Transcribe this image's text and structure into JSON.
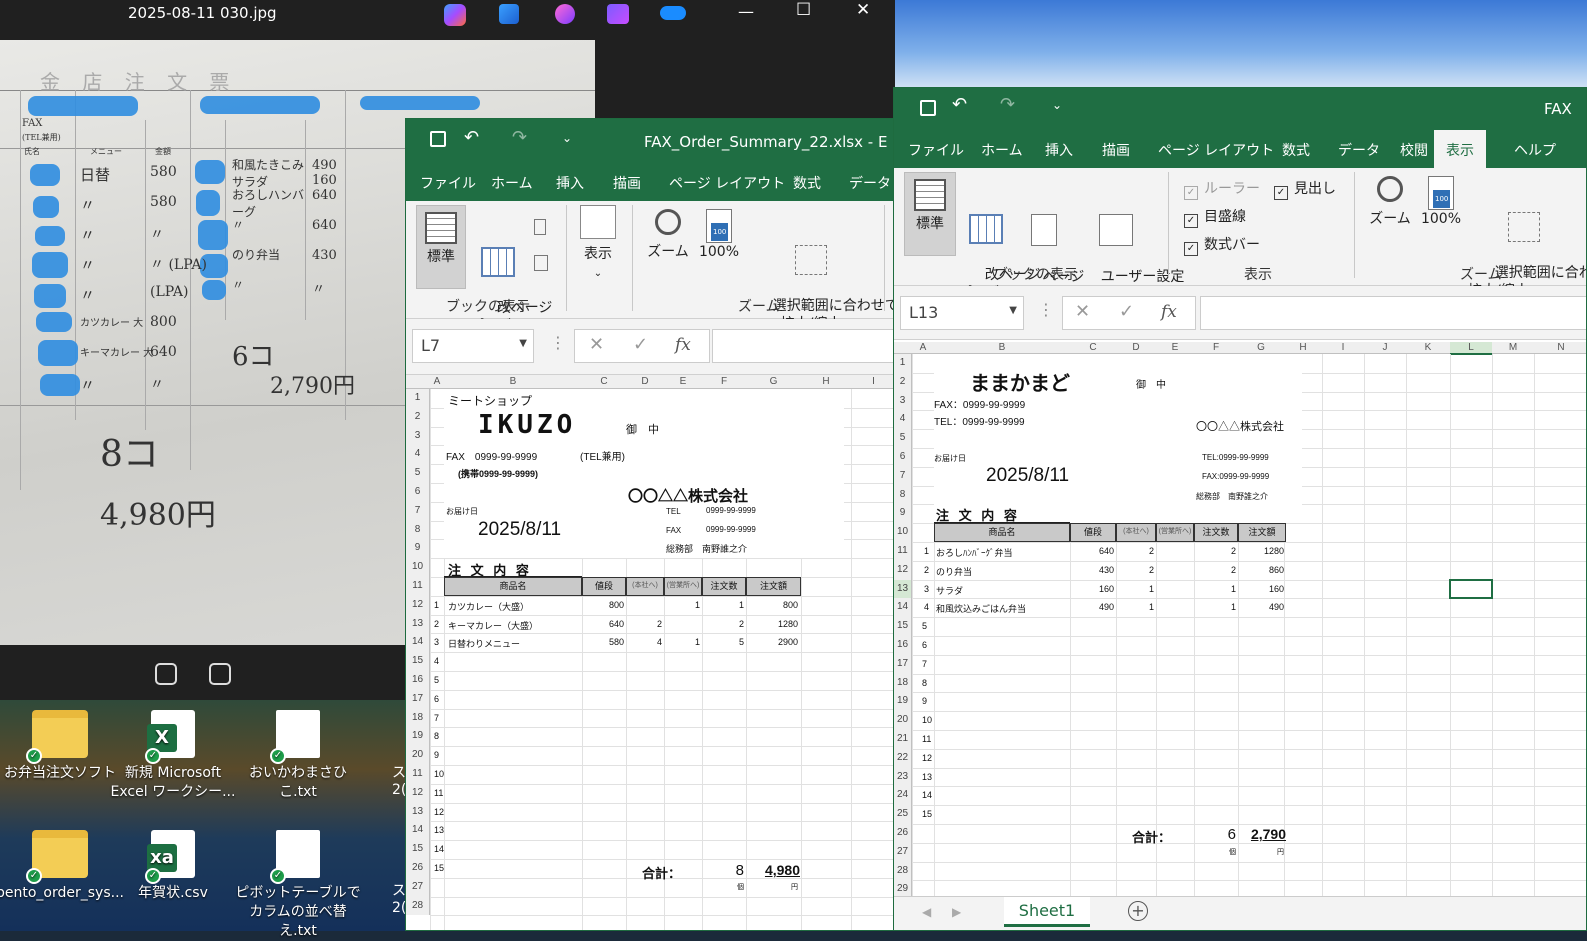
{
  "photo_viewer": {
    "title": "2025-08-11 030.jpg",
    "min_glyph": "—",
    "max_glyph": "☐",
    "close_glyph": "✕",
    "handwriting": {
      "header": "金 店 注 文 票",
      "fax_tel": "FAX",
      "tel_label": "(TEL兼用)",
      "col_name": "氏名",
      "col_menu": "メニュー",
      "col_price": "金額",
      "rows": [
        {
          "menu": "日替",
          "price": "580",
          "menu2": "和風たきこみ サラダ",
          "price2": "490 160"
        },
        {
          "menu": "〃",
          "price": "580",
          "menu2": "おろしハンバーグ",
          "price2": "640"
        },
        {
          "menu": "〃",
          "price": "〃",
          "menu2": "〃",
          "price2": "640"
        },
        {
          "menu": "〃",
          "price": "〃 (LPA)",
          "menu2": "のり弁当",
          "price2": "430"
        },
        {
          "menu": "〃",
          "price": "(LPA)",
          "menu2": "〃",
          "price2": "〃"
        },
        {
          "menu": "カツカレー 大",
          "price": "800",
          "menu2": "",
          "price2": ""
        },
        {
          "menu": "キーマカレー 大",
          "price": "640",
          "menu2": "6コ",
          "price2": ""
        },
        {
          "menu": "〃",
          "price": "〃",
          "menu2": "",
          "price2": "2,790円"
        }
      ],
      "count_total": "8コ",
      "yen_total": "4,980円"
    }
  },
  "desktop": {
    "icons": [
      {
        "label": "お弁当注文ソフト",
        "type": "folder"
      },
      {
        "label": "新規 Microsoft Excel ワークシー...",
        "type": "xlsx"
      },
      {
        "label": "おいかわまさひこ.txt",
        "type": "txt"
      },
      {
        "label": "bento_order_sys...",
        "type": "folder"
      },
      {
        "label": "年賀状.csv",
        "type": "csv"
      },
      {
        "label": "ピボットテーブルでカラムの並べ替え.txt",
        "type": "txt"
      }
    ],
    "partial": [
      "ス",
      "2(",
      "ス",
      "2("
    ]
  },
  "excel_left": {
    "title": "FAX_Order_Summary_22.xlsx - E",
    "tabs": [
      "ファイル",
      "ホーム",
      "挿入",
      "描画",
      "ページ レイアウト",
      "数式",
      "データ"
    ],
    "ribbon": {
      "normal": "標準",
      "page_break": "改ページ\nプレビュー",
      "group_book": "ブックの表示",
      "show": "表示",
      "zoom": "ズーム",
      "zoom100": "100%",
      "zoom_sel": "選択範囲に合わせて\n拡大/縮小",
      "group_zoom": "ズーム"
    },
    "name_box": "L7",
    "fx": "fx",
    "columns": [
      "A",
      "B",
      "C",
      "D",
      "E",
      "F",
      "G",
      "H",
      "I"
    ],
    "rows": [
      "1",
      "2",
      "3",
      "4",
      "5",
      "6",
      "7",
      "8",
      "9",
      "10",
      "11",
      "12",
      "13",
      "14",
      "15",
      "16",
      "17",
      "18",
      "19",
      "20",
      "11",
      "12",
      "13",
      "14",
      "15",
      "26",
      "27",
      "28"
    ],
    "sheet": {
      "shop": "ミートショップ",
      "name": "IKUZO",
      "onchu": "御　中",
      "fax": "FAX　0999-99-9999",
      "tel_kenyo": "(TEL兼用)",
      "mobile": "(携帯0999-99-9999)",
      "company": "〇〇△△株式会社",
      "deliv": "お届け日",
      "date": "2025/8/11",
      "tel_l": "TEL",
      "tel_v": "0999-99-9999",
      "fax_l": "FAX",
      "fax_v": "0999-99-9999",
      "dept": "総務部　南野誰之介",
      "order": "注 文 内 容",
      "head": [
        "商品名",
        "値段",
        "(本社へ)",
        "(営業所へ)",
        "注文数",
        "注文額"
      ],
      "items": [
        {
          "no": "1",
          "name": "カツカレー（大盛）",
          "price": "800",
          "c1": "",
          "c2": "1",
          "qty": "1",
          "amt": "800"
        },
        {
          "no": "2",
          "name": "キーマカレー（大盛）",
          "price": "640",
          "c1": "2",
          "c2": "",
          "qty": "2",
          "amt": "1280"
        },
        {
          "no": "3",
          "name": "日替わりメニュー",
          "price": "580",
          "c1": "4",
          "c2": "1",
          "qty": "5",
          "amt": "2900"
        }
      ],
      "extra_no": [
        "4",
        "5",
        "6",
        "7",
        "8",
        "9",
        "10",
        "11",
        "12",
        "13",
        "14",
        "15"
      ],
      "total_label": "合計：",
      "total_qty": "8",
      "total_amt": "4,980",
      "unit_qty": "個",
      "unit_amt": "円"
    }
  },
  "excel_right": {
    "title": "FAX",
    "tabs": [
      "ファイル",
      "ホーム",
      "挿入",
      "描画",
      "ページ レイアウト",
      "数式",
      "データ",
      "校閲",
      "表示",
      "ヘルプ"
    ],
    "active_tab": "表示",
    "ribbon": {
      "normal": "標準",
      "page_break": "改ページ\nプレビュー",
      "page_layout": "ページ\nレイアウト",
      "custom": "ユーザー設定\nのビュー",
      "group_book": "ブックの表示",
      "ruler": "ルーラー",
      "heading": "見出し",
      "gridlines": "目盛線",
      "formula_bar": "数式バー",
      "group_show": "表示",
      "zoom": "ズーム",
      "zoom100": "100%",
      "zoom_sel": "選択範囲に合わ\n拡大/縮小",
      "group_zoom": "ズーム"
    },
    "name_box": "L13",
    "fx": "fx",
    "columns": [
      "A",
      "B",
      "C",
      "D",
      "E",
      "F",
      "G",
      "H",
      "I",
      "J",
      "K",
      "L",
      "M",
      "N"
    ],
    "rows": [
      "1",
      "2",
      "3",
      "4",
      "5",
      "6",
      "7",
      "8",
      "9",
      "10",
      "11",
      "12",
      "13",
      "14",
      "15",
      "16",
      "17",
      "18",
      "19",
      "20",
      "21",
      "22",
      "23",
      "24",
      "25",
      "26",
      "27",
      "28",
      "29",
      "30",
      "31"
    ],
    "sheet": {
      "name": "ままかまど",
      "onchu": "御　中",
      "fax": "FAX：0999-99-9999",
      "tel": "TEL：0999-99-9999",
      "company": "〇〇△△株式会社",
      "deliv": "お届け日",
      "date": "2025/8/11",
      "tel_r": "TEL:0999-99-9999",
      "fax_r": "FAX:0999-99-9999",
      "dept": "総務部　南野誰之介",
      "order": "注 文 内 容",
      "head": [
        "商品名",
        "値段",
        "(本社へ)",
        "(営業所へ)",
        "注文数",
        "注文額"
      ],
      "items": [
        {
          "no": "1",
          "name": "おろしﾊﾝﾊﾞｰｸﾞ弁当",
          "price": "640",
          "c1": "2",
          "qty": "2",
          "amt": "1280"
        },
        {
          "no": "2",
          "name": "のり弁当",
          "price": "430",
          "c1": "2",
          "qty": "2",
          "amt": "860"
        },
        {
          "no": "3",
          "name": "サラダ",
          "price": "160",
          "c1": "1",
          "qty": "1",
          "amt": "160"
        },
        {
          "no": "4",
          "name": "和風炊込みごはん弁当",
          "price": "490",
          "c1": "1",
          "qty": "1",
          "amt": "490"
        }
      ],
      "extra_no": [
        "5",
        "6",
        "7",
        "8",
        "9",
        "10",
        "11",
        "12",
        "13",
        "14",
        "15"
      ],
      "total_label": "合計：",
      "total_qty": "6",
      "total_amt": "2,790",
      "unit_qty": "個",
      "unit_amt": "円"
    },
    "sheet_tab": "Sheet1"
  }
}
